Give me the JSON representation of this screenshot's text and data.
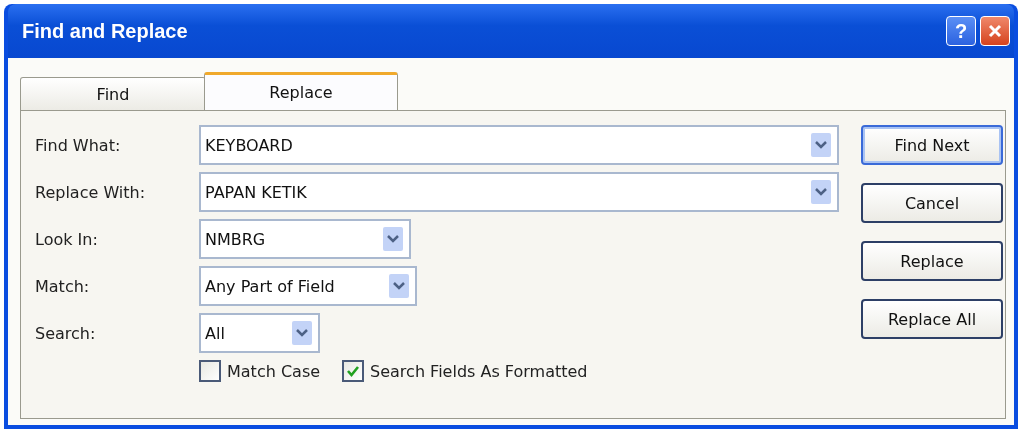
{
  "window": {
    "title": "Find and Replace",
    "help_button": "?"
  },
  "tabs": [
    {
      "label": "Find",
      "selected": false
    },
    {
      "label": "Replace",
      "selected": true
    }
  ],
  "fields": [
    {
      "label": "Find What:",
      "value": "KEYBOARD"
    },
    {
      "label": "Replace With:",
      "value": "PAPAN KETIK"
    },
    {
      "label": "Look In:",
      "value": "NMBRG"
    },
    {
      "label": "Match:",
      "value": "Any Part of Field"
    },
    {
      "label": "Search:",
      "value": "All"
    }
  ],
  "options": [
    {
      "label": "Match Case",
      "checked": false
    },
    {
      "label": "Search Fields As Formatted",
      "checked": true
    }
  ],
  "buttons": [
    {
      "label": "Find Next",
      "default": true
    },
    {
      "label": "Cancel",
      "default": false
    },
    {
      "label": "Replace",
      "default": false
    },
    {
      "label": "Replace All",
      "default": false
    }
  ]
}
